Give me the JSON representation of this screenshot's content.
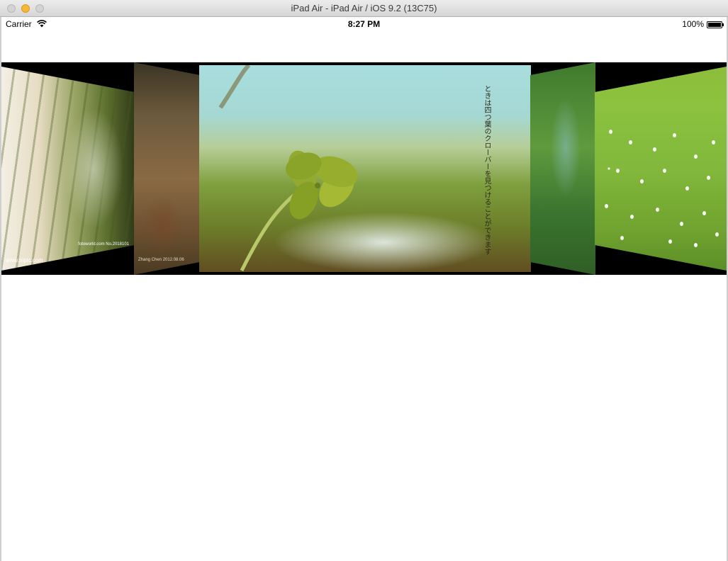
{
  "window": {
    "title": "iPad Air - iPad Air / iOS 9.2 (13C75)"
  },
  "status_bar": {
    "carrier": "Carrier",
    "time": "8:27 PM",
    "battery": "100%",
    "icons": [
      "wifi-icon",
      "battery-icon"
    ]
  },
  "carousel": {
    "cards": [
      {
        "name": "white-flowers-photo",
        "watermark": "www.nipic.com",
        "watermark2": "fotoworld.com No.2018101"
      },
      {
        "name": "blurred-bokeh-photo",
        "watermark": "Zhang Chen  2012.08.06"
      },
      {
        "name": "four-leaf-clover-photo",
        "caption": "ときは四つ葉のクローバーを見つけることができます"
      },
      {
        "name": "green-bokeh-photo"
      },
      {
        "name": "white-blossom-meadow-photo"
      }
    ]
  },
  "colors": {
    "carousel_background": "#000000",
    "traffic_minimize": "#f6b935"
  }
}
